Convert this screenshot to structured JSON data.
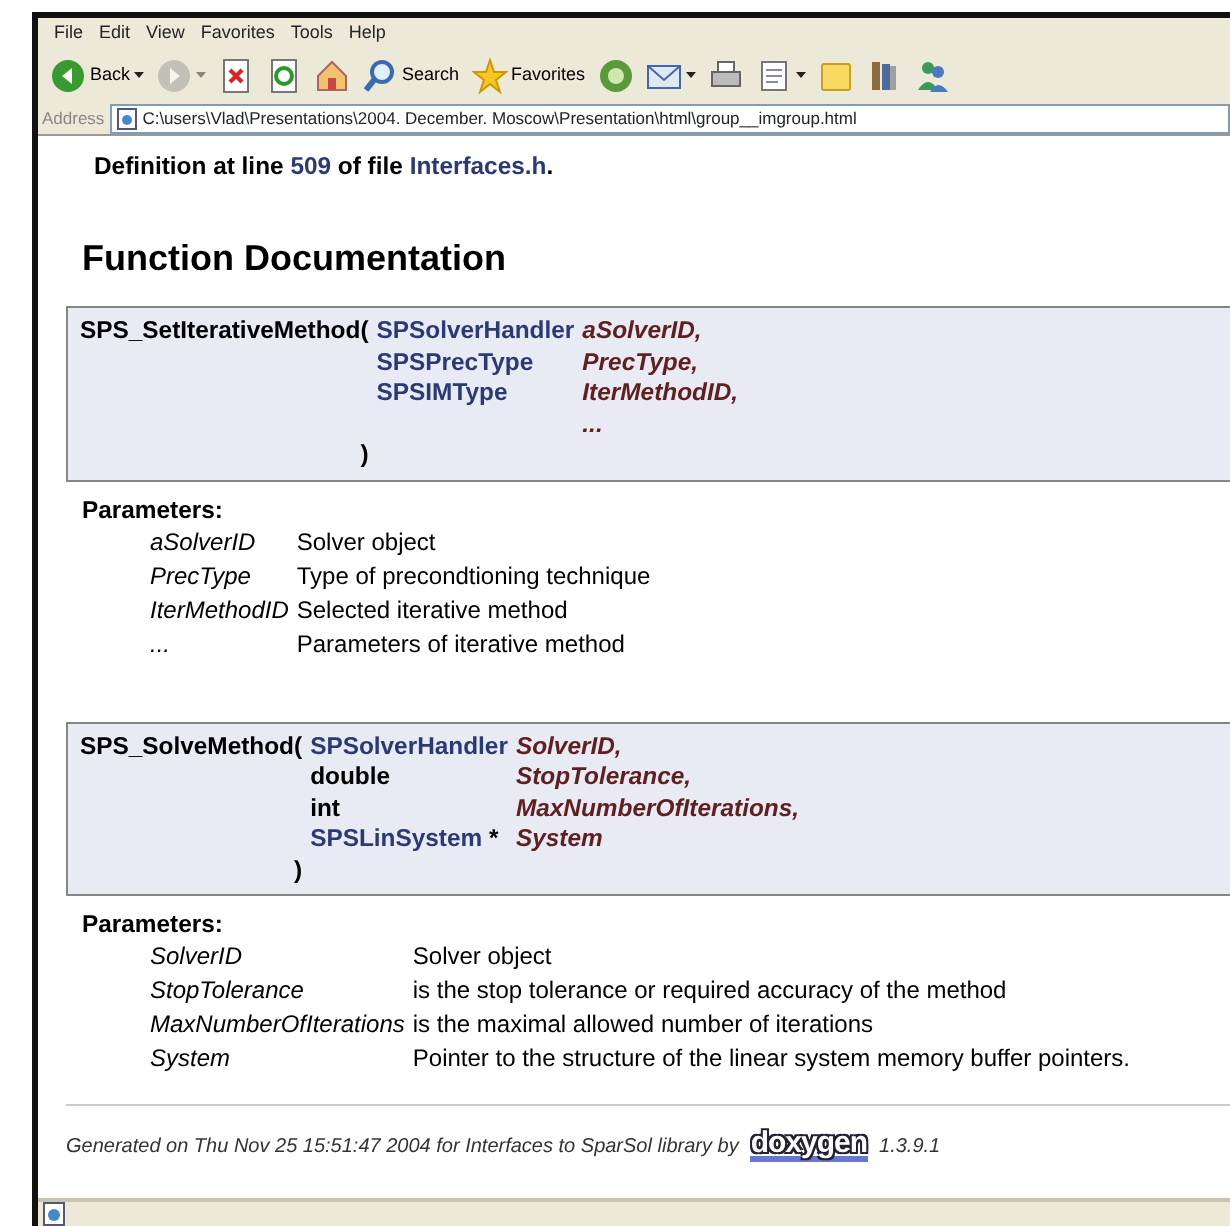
{
  "menu": [
    "File",
    "Edit",
    "View",
    "Favorites",
    "Tools",
    "Help"
  ],
  "toolbar": [
    {
      "kind": "back",
      "label": "Back",
      "dropdown": true,
      "disabled": false
    },
    {
      "kind": "forward",
      "dropdown": true,
      "disabled": true
    },
    {
      "kind": "stop",
      "dropdown": false,
      "disabled": false
    },
    {
      "kind": "refresh",
      "dropdown": false,
      "disabled": false
    },
    {
      "kind": "home",
      "dropdown": false,
      "disabled": false
    },
    {
      "kind": "search",
      "label": "Search",
      "dropdown": false,
      "disabled": false
    },
    {
      "kind": "favorites",
      "label": "Favorites",
      "dropdown": false,
      "disabled": false
    },
    {
      "kind": "media",
      "dropdown": false,
      "disabled": false
    },
    {
      "kind": "mail",
      "dropdown": true,
      "disabled": false
    },
    {
      "kind": "print",
      "dropdown": false,
      "disabled": false
    },
    {
      "kind": "edit",
      "dropdown": true,
      "disabled": false
    },
    {
      "kind": "note",
      "dropdown": false,
      "disabled": false
    },
    {
      "kind": "research",
      "dropdown": false,
      "disabled": false
    },
    {
      "kind": "messenger",
      "dropdown": false,
      "disabled": false
    }
  ],
  "address": {
    "label": "Address",
    "url": "C:\\users\\Vlad\\Presentations\\2004. December. Moscow\\Presentation\\html\\group__imgroup.html"
  },
  "definition": [
    {
      "text": "Definition at line ",
      "link": false
    },
    {
      "text": "509",
      "link": true
    },
    {
      "text": " of file ",
      "link": false
    },
    {
      "text": "Interfaces.h",
      "link": true
    },
    {
      "text": ".",
      "link": false
    }
  ],
  "heading": "Function Documentation",
  "functions": [
    {
      "name": "SPS_SetIterativeMethod(",
      "close": ")",
      "params": [
        {
          "type": "SPSolverHandler",
          "type_link": true,
          "name": "aSolverID,"
        },
        {
          "type": "SPSPrecType",
          "type_link": true,
          "name": "PrecType,"
        },
        {
          "type": "SPSIMType",
          "type_link": true,
          "name": "IterMethodID,"
        },
        {
          "name": "..."
        }
      ],
      "parameters_label": "Parameters:",
      "docs": [
        {
          "name": "aSolverID",
          "text": "Solver object"
        },
        {
          "name": "PrecType",
          "text": "Type of precondtioning technique"
        },
        {
          "name": "IterMethodID",
          "text": "Selected iterative method"
        },
        {
          "name": "...",
          "text": "Parameters of iterative method"
        }
      ]
    },
    {
      "name": "SPS_SolveMethod(",
      "close": ")",
      "params": [
        {
          "type": "SPSolverHandler",
          "type_link": true,
          "name": "SolverID,"
        },
        {
          "type": "double",
          "type_link": false,
          "name": "StopTolerance,"
        },
        {
          "type": "int",
          "type_link": false,
          "name": "MaxNumberOfIterations,"
        },
        {
          "type": "SPSLinSystem",
          "type_link": true,
          "type_suffix": " *",
          "name": "System"
        }
      ],
      "parameters_label": "Parameters:",
      "docs": [
        {
          "name": "SolverID",
          "text": "Solver object"
        },
        {
          "name": "StopTolerance",
          "text": "is the stop tolerance or required accuracy of the method"
        },
        {
          "name": "MaxNumberOfIterations",
          "text": "is the maximal allowed number of iterations"
        },
        {
          "name": "System",
          "text": "Pointer to the structure of the linear system memory buffer pointers."
        }
      ]
    }
  ],
  "footer": {
    "text": "Generated on Thu Nov 25 15:51:47 2004 for Interfaces to SparSol library by",
    "logo": "doxygen",
    "version": "1.3.9.1"
  }
}
